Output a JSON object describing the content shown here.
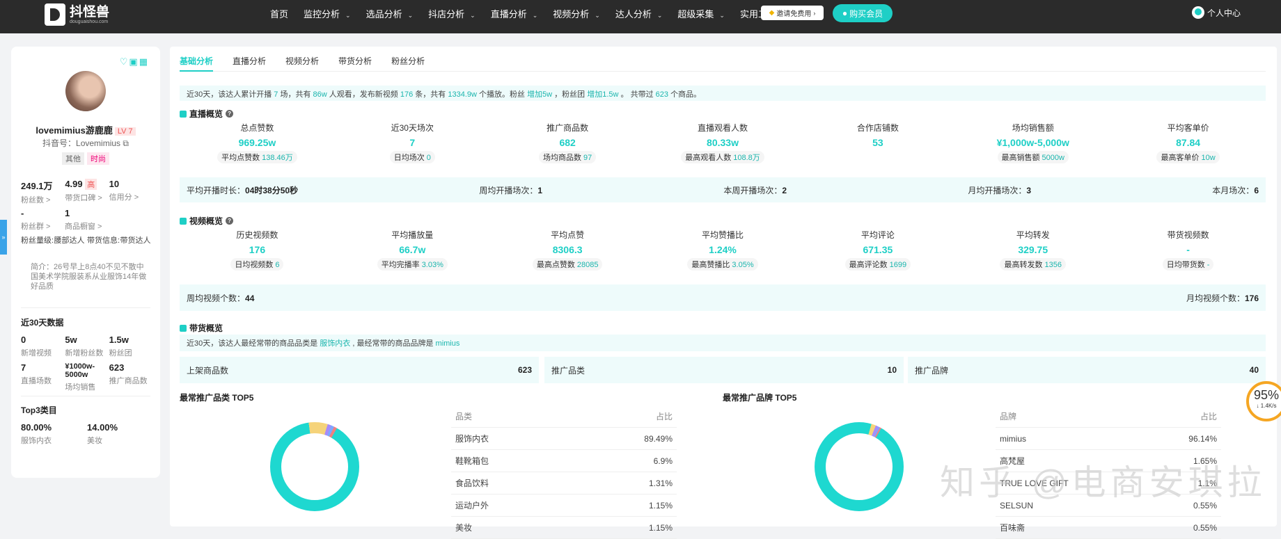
{
  "topbar": {
    "logo_name": "抖怪兽",
    "logo_sub": "douguaishou.com",
    "nav": [
      {
        "label": "首页",
        "dropdown": false
      },
      {
        "label": "监控分析",
        "dropdown": true
      },
      {
        "label": "选品分析",
        "dropdown": true
      },
      {
        "label": "抖店分析",
        "dropdown": true
      },
      {
        "label": "直播分析",
        "dropdown": true
      },
      {
        "label": "视频分析",
        "dropdown": true
      },
      {
        "label": "达人分析",
        "dropdown": true
      },
      {
        "label": "超级采集",
        "dropdown": true
      },
      {
        "label": "实用工具",
        "dropdown": true
      }
    ],
    "free_label": "邀请免费用",
    "buy_label": "购买会员",
    "user_center": "个人中心"
  },
  "profile": {
    "name": "lovemimius游鹿鹿",
    "level": "LV 7",
    "douyin_id": "抖音号：Lovemimius",
    "tags": [
      "其他",
      "时尚"
    ],
    "stats1": [
      {
        "value": "249.1万",
        "label": "粉丝数 >"
      },
      {
        "value": "4.99",
        "badge": "高",
        "label": "带货口碑 >"
      },
      {
        "value": "10",
        "label": "信用分 >"
      }
    ],
    "stats2": [
      {
        "value": "-",
        "label": "粉丝群 >"
      },
      {
        "value": "1",
        "label": "商品橱窗 >"
      }
    ],
    "fan_level": [
      "粉丝量级:",
      "腰部达人",
      "带货信息:",
      "带货达人"
    ],
    "intro": "简介：26号早上8点40不见不散中国美术学院服装系从业服饰14年做好品质",
    "recent_title": "近30天数据",
    "recent": [
      {
        "value": "0",
        "label": "新增视频"
      },
      {
        "value": "5w",
        "label": "新增粉丝数"
      },
      {
        "value": "1.5w",
        "label": "粉丝团"
      },
      {
        "value": "7",
        "label": "直播场数"
      },
      {
        "value": "¥1000w-5000w",
        "label": "场均销售"
      },
      {
        "value": "623",
        "label": "推广商品数"
      }
    ],
    "top3_title": "Top3类目",
    "top3": [
      {
        "value": "80.00%",
        "label": "服饰内衣"
      },
      {
        "value": "14.00%",
        "label": "美妆"
      }
    ]
  },
  "tabs": [
    "基础分析",
    "直播分析",
    "视频分析",
    "带货分析",
    "粉丝分析"
  ],
  "summary": {
    "t1": "近30天，该达人累计开播 ",
    "v1": "7",
    "t2": " 场，共有 ",
    "v2": "86w",
    "t3": " 人观看，发布新视频 ",
    "v3": "176",
    "t4": " 条，共有 ",
    "v4": "1334.9w",
    "t5": " 个播放。粉丝 ",
    "v5": "增加5w",
    "t6": " ，粉丝团 ",
    "v6": "增加1.5w",
    "t7": " 。 共带过 ",
    "v7": "623",
    "t8": " 个商品。"
  },
  "live": {
    "title": "直播概览",
    "kpis": [
      {
        "label": "总点赞数",
        "value": "969.25w",
        "sub_label": "平均点赞数",
        "sub_value": "138.46万"
      },
      {
        "label": "近30天场次",
        "value": "7",
        "sub_label": "日均场次",
        "sub_value": "0"
      },
      {
        "label": "推广商品数",
        "value": "682",
        "sub_label": "场均商品数",
        "sub_value": "97"
      },
      {
        "label": "直播观看人数",
        "value": "80.33w",
        "sub_label": "最高观看人数",
        "sub_value": "108.8万"
      },
      {
        "label": "合作店铺数",
        "value": "53",
        "sub_label": "",
        "sub_value": ""
      },
      {
        "label": "场均销售额",
        "value": "¥1,000w-5,000w",
        "sub_label": "最高销售额",
        "sub_value": "5000w"
      },
      {
        "label": "平均客单价",
        "value": "87.84",
        "sub_label": "最高客单价",
        "sub_value": "10w"
      }
    ],
    "band": [
      {
        "label": "平均开播时长：",
        "value": "04时38分50秒"
      },
      {
        "label": "周均开播场次：",
        "value": "1"
      },
      {
        "label": "本周开播场次：",
        "value": "2"
      },
      {
        "label": "月均开播场次：",
        "value": "3"
      },
      {
        "label": "本月场次：",
        "value": "6"
      }
    ]
  },
  "video": {
    "title": "视频概览",
    "kpis": [
      {
        "label": "历史视频数",
        "value": "176",
        "sub_label": "日均视频数",
        "sub_value": "6"
      },
      {
        "label": "平均播放量",
        "value": "66.7w",
        "sub_label": "平均完播率",
        "sub_value": "3.03%"
      },
      {
        "label": "平均点赞",
        "value": "8306.3",
        "sub_label": "最高点赞数",
        "sub_value": "28085"
      },
      {
        "label": "平均赞播比",
        "value": "1.24%",
        "sub_label": "最高赞播比",
        "sub_value": "3.05%"
      },
      {
        "label": "平均评论",
        "value": "671.35",
        "sub_label": "最高评论数",
        "sub_value": "1699"
      },
      {
        "label": "平均转发",
        "value": "329.75",
        "sub_label": "最高转发数",
        "sub_value": "1356"
      },
      {
        "label": "带货视频数",
        "value": "-",
        "sub_label": "日均带货数",
        "sub_value": "-"
      }
    ],
    "band": [
      {
        "label": "周均视频个数：",
        "value": "44"
      },
      {
        "label": "月均视频个数：",
        "value": "176"
      }
    ]
  },
  "goods": {
    "title": "带货概览",
    "summary_t1": "近30天，该达人最经常带的商品品类是 ",
    "summary_v1": "服饰内衣",
    "summary_t2": " , 最经常带的商品品牌是 ",
    "summary_v2": "mimius",
    "cards": [
      {
        "label": "上架商品数",
        "value": "623"
      },
      {
        "label": "推广品类",
        "value": "10"
      },
      {
        "label": "推广品牌",
        "value": "40"
      }
    ]
  },
  "top_category": {
    "title": "最常推广品类 TOP5",
    "col1": "品类",
    "col2": "占比",
    "rows": [
      {
        "name": "服饰内衣",
        "pct": "89.49%"
      },
      {
        "name": "鞋靴箱包",
        "pct": "6.9%"
      },
      {
        "name": "食品饮料",
        "pct": "1.31%"
      },
      {
        "name": "运动户外",
        "pct": "1.15%"
      },
      {
        "name": "美妆",
        "pct": "1.15%"
      }
    ],
    "colors": [
      "#1ed8d0",
      "#f5d37a",
      "#a78bfa",
      "#7ea7ff",
      "#f08080"
    ]
  },
  "top_brand": {
    "title": "最常推广品牌 TOP5",
    "col1": "品牌",
    "col2": "占比",
    "rows": [
      {
        "name": "mimius",
        "pct": "96.14%"
      },
      {
        "name": "高梵屋",
        "pct": "1.65%"
      },
      {
        "name": "TRUE LOVE GIFT",
        "pct": "1.1%"
      },
      {
        "name": "SELSUN",
        "pct": "0.55%"
      },
      {
        "name": "百味斋",
        "pct": "0.55%"
      }
    ],
    "colors": [
      "#1ed8d0",
      "#f5d37a",
      "#a78bfa",
      "#7ea7ff",
      "#f08080"
    ]
  },
  "overlay": {
    "watermark": "知乎 @电商安琪拉",
    "speed_pct": "95%",
    "speed_rate": "↓ 1.4K/s"
  }
}
